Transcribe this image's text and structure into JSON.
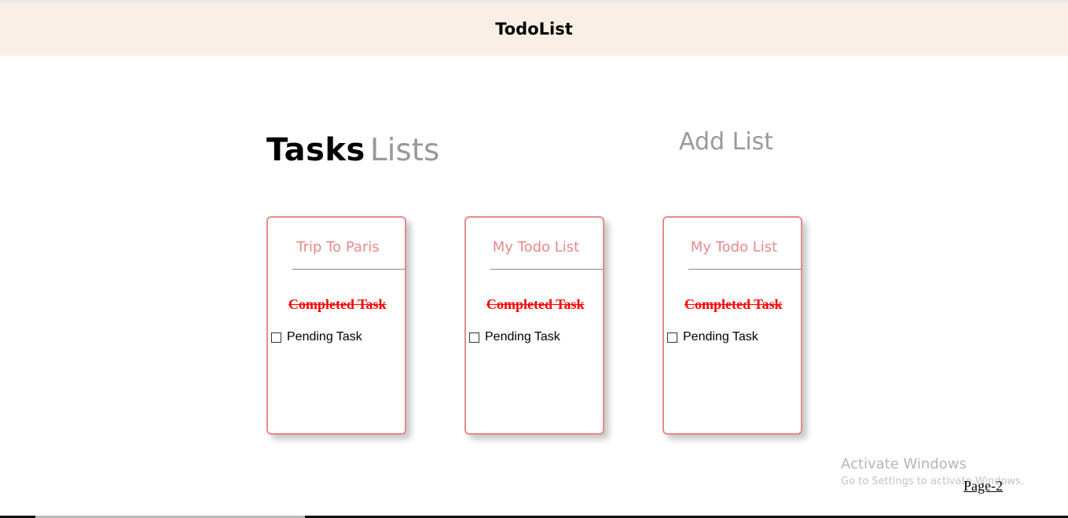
{
  "header": {
    "title": "TodoList"
  },
  "heading": {
    "bold": "Tasks",
    "light": "Lists"
  },
  "actions": {
    "add_list": "Add List"
  },
  "lists": [
    {
      "title": "Trip To Paris",
      "completed_task": "Completed Task",
      "pending_task": "Pending Task"
    },
    {
      "title": "My Todo List",
      "completed_task": "Completed Task",
      "pending_task": "Pending Task"
    },
    {
      "title": "My Todo List",
      "completed_task": "Completed Task",
      "pending_task": "Pending Task"
    }
  ],
  "watermark": {
    "title": "Activate Windows",
    "subtitle": "Go to Settings to activate Windows."
  },
  "pagination": {
    "link": "Page-2"
  },
  "colors": {
    "header_bg": "#f9efe6",
    "accent": "#e88a8a",
    "completed": "#ff0000"
  }
}
